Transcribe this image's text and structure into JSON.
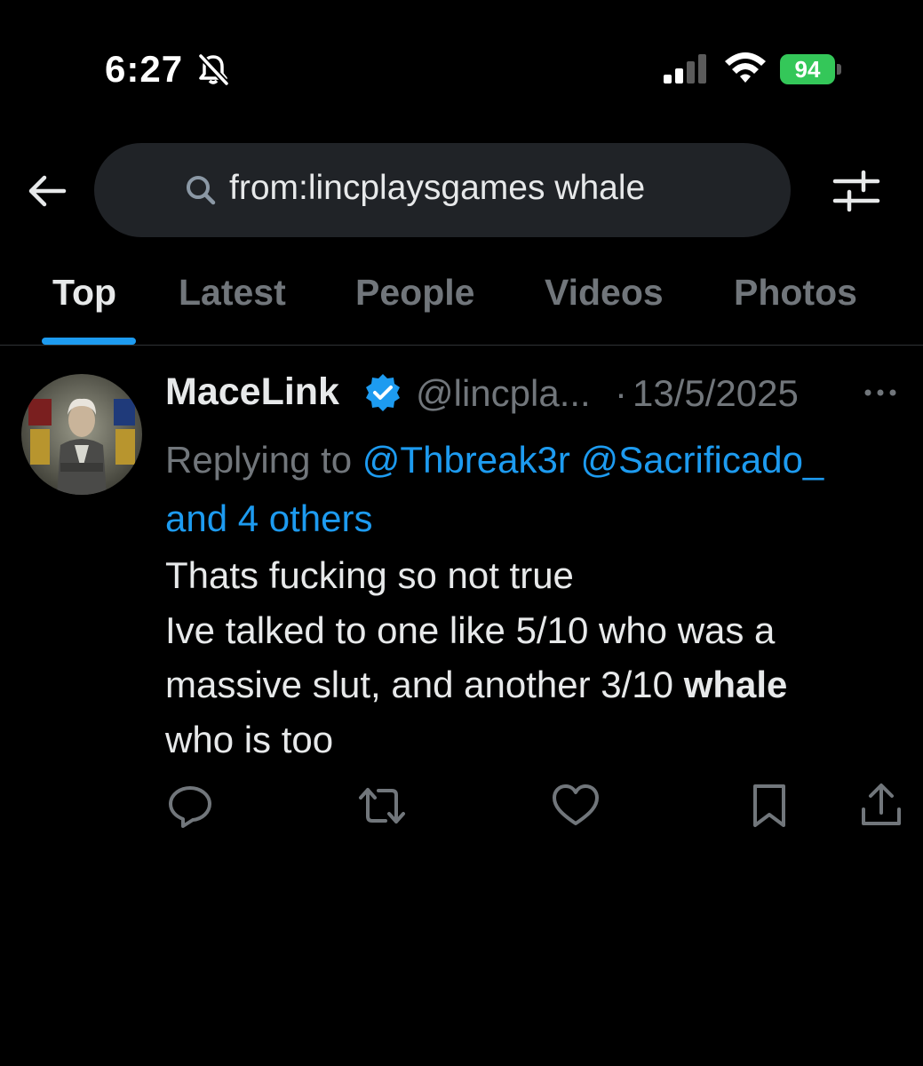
{
  "status_bar": {
    "time": "6:27",
    "battery": "94"
  },
  "search": {
    "query": "from:lincplaysgames whale"
  },
  "tabs": [
    {
      "label": "Top",
      "active": true
    },
    {
      "label": "Latest",
      "active": false
    },
    {
      "label": "People",
      "active": false
    },
    {
      "label": "Videos",
      "active": false
    },
    {
      "label": "Photos",
      "active": false
    }
  ],
  "tweet": {
    "display_name": "MaceLink",
    "handle": "@lincpla...",
    "separator": "·",
    "date": "13/5/2025",
    "replying_prefix": "Replying to",
    "mention_1": "@Thbreak3r",
    "mention_2": "@Sacrificado_",
    "mention_others": "and 4 others",
    "line_1": "Thats fucking so not true",
    "line_2a": "Ive talked to one like 5/10 who was a",
    "line_2b": "massive slut, and another 3/10",
    "highlight": "whale",
    "line_2c": "who is too"
  },
  "colors": {
    "accent": "#1d9bf0",
    "muted": "#71767b",
    "battery": "#34c759"
  },
  "icons": [
    "bell-slash-icon",
    "signal-icon",
    "wifi-icon",
    "back-arrow-icon",
    "search-icon",
    "filter-icon",
    "verified-icon",
    "more-icon",
    "reply-icon",
    "retweet-icon",
    "like-icon",
    "bookmark-icon",
    "share-icon"
  ]
}
